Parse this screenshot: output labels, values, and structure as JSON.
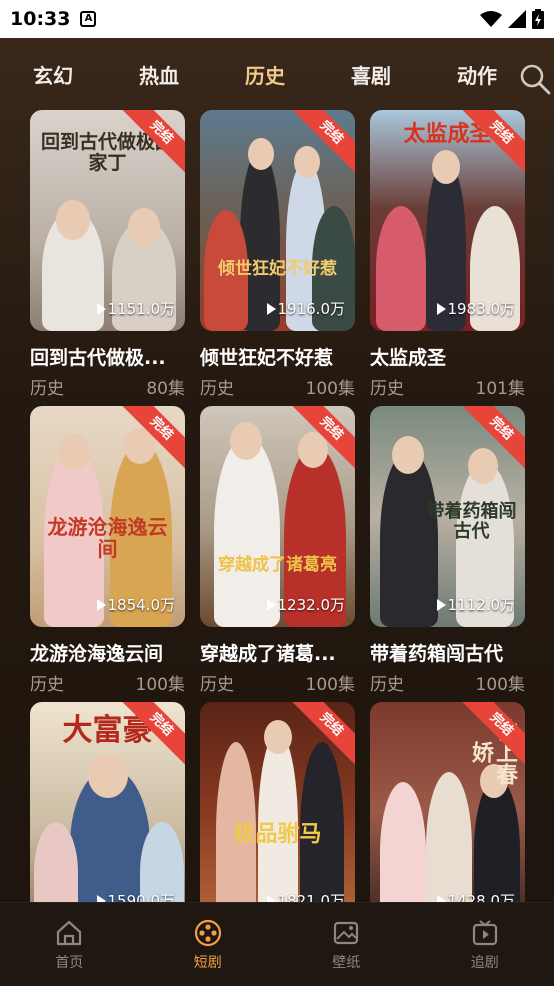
{
  "status_bar": {
    "time": "10:33",
    "a_badge": "A"
  },
  "tabs": [
    {
      "label": "玄幻",
      "active": false
    },
    {
      "label": "热血",
      "active": false
    },
    {
      "label": "历史",
      "active": true
    },
    {
      "label": "喜剧",
      "active": false
    },
    {
      "label": "动作",
      "active": false
    }
  ],
  "badge_label": "完结",
  "dramas": [
    {
      "title": "回到古代做极...",
      "genre": "历史",
      "episodes": "80集",
      "plays": "1151.0万",
      "poster_text": "回到古代做极品家丁"
    },
    {
      "title": "倾世狂妃不好惹",
      "genre": "历史",
      "episodes": "100集",
      "plays": "1916.0万",
      "poster_text": "倾世狂妃不好惹"
    },
    {
      "title": "太监成圣",
      "genre": "历史",
      "episodes": "101集",
      "plays": "1983.0万",
      "poster_text": "太监成圣"
    },
    {
      "title": "龙游沧海逸云间",
      "genre": "历史",
      "episodes": "100集",
      "plays": "1854.0万",
      "poster_text": "龙游沧海逸云间"
    },
    {
      "title": "穿越成了诸葛...",
      "genre": "历史",
      "episodes": "100集",
      "plays": "1232.0万",
      "poster_text": "穿越成了诸葛亮"
    },
    {
      "title": "带着药箱闯古代",
      "genre": "历史",
      "episodes": "100集",
      "plays": "1112.0万",
      "poster_text": "带着药箱闯古代"
    },
    {
      "title": "",
      "genre": "",
      "episodes": "",
      "plays": "1590.0万",
      "poster_text": "大富豪"
    },
    {
      "title": "",
      "genre": "",
      "episodes": "",
      "plays": "1821.0万",
      "poster_text": "极品驸马"
    },
    {
      "title": "",
      "genre": "",
      "episodes": "",
      "plays": "1428.0万",
      "poster_text": "枕上春娇"
    }
  ],
  "bottom_nav": [
    {
      "label": "首页",
      "icon": "home-icon",
      "active": false
    },
    {
      "label": "短剧",
      "icon": "film-reel-icon",
      "active": true
    },
    {
      "label": "壁纸",
      "icon": "wallpaper-icon",
      "active": false
    },
    {
      "label": "追剧",
      "icon": "tv-play-icon",
      "active": false
    }
  ],
  "colors": {
    "accent": "#f1a142",
    "active_tab": "#f3c98b",
    "badge": "#e8453a"
  }
}
